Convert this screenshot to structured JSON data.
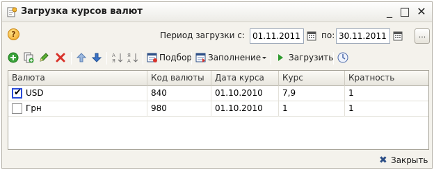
{
  "window": {
    "title": "Загрузка курсов валют",
    "minimize_glyph": "_",
    "maximize_glyph": "□",
    "close_glyph": "✕"
  },
  "period": {
    "label_from": "Период загрузки с:",
    "date_from": "01.11.2011",
    "label_to": "по:",
    "date_to": "30.11.2011",
    "more_button": "..."
  },
  "toolbar": {
    "icons": [
      "add-icon",
      "copy-icon",
      "edit-icon",
      "delete-icon",
      "move-up-icon",
      "move-down-icon",
      "sort-ascending-icon",
      "sort-descending-icon",
      "select-icon",
      "fill-icon",
      "load-icon",
      "history-icon"
    ],
    "select_label": "Подбор",
    "fill_label": "Заполнение",
    "load_label": "Загрузить"
  },
  "table": {
    "columns": [
      "Валюта",
      "Код валюты",
      "Дата курса",
      "Курс",
      "Кратность"
    ],
    "rows": [
      {
        "checked": true,
        "currency": "USD",
        "code": "840",
        "date": "01.10.2010",
        "rate": "7,9",
        "multiplicity": "1"
      },
      {
        "checked": false,
        "currency": "Грн",
        "code": "980",
        "date": "01.10.2010",
        "rate": "1",
        "multiplicity": "1"
      }
    ]
  },
  "footer": {
    "close_label": "Закрыть"
  },
  "colors": {
    "accent": "#2a4bd7",
    "add_green": "#3aa23a",
    "delete_red": "#d8322a",
    "arrow_blue": "#3b73c8"
  }
}
